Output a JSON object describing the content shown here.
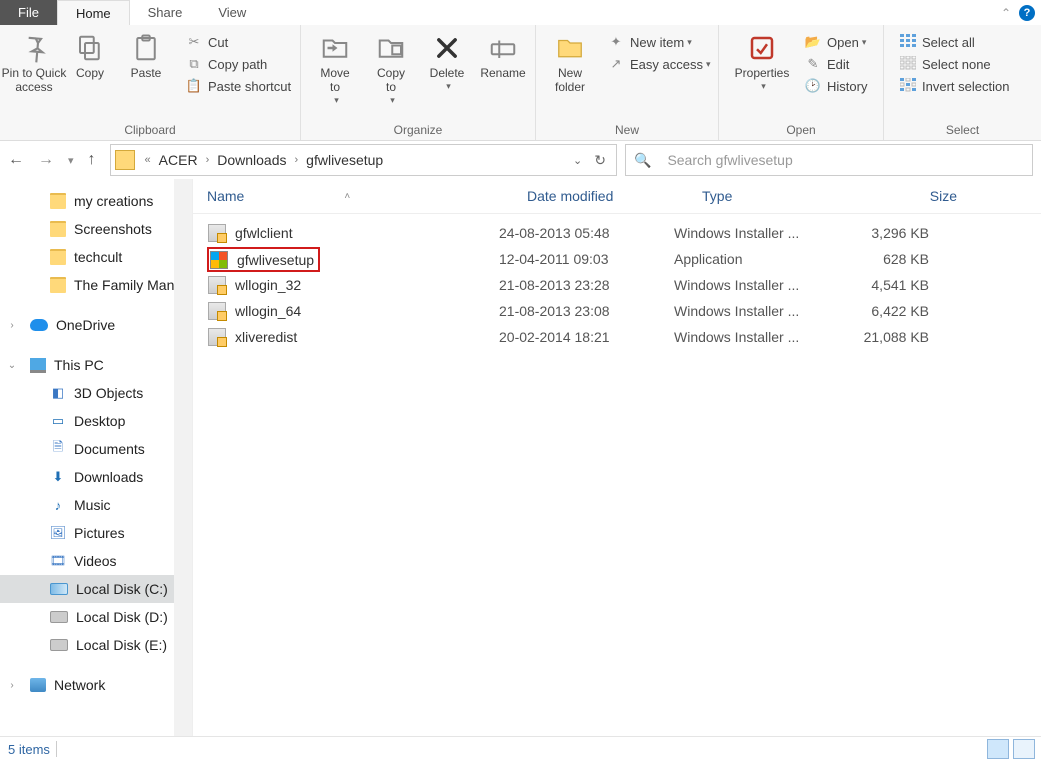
{
  "tabs": {
    "file": "File",
    "home": "Home",
    "share": "Share",
    "view": "View"
  },
  "ribbon": {
    "clipboard": {
      "label": "Clipboard",
      "pin": "Pin to Quick\naccess",
      "copy": "Copy",
      "paste": "Paste",
      "cut": "Cut",
      "copy_path": "Copy path",
      "paste_shortcut": "Paste shortcut"
    },
    "organize": {
      "label": "Organize",
      "move_to": "Move\nto",
      "copy_to": "Copy\nto",
      "delete": "Delete",
      "rename": "Rename"
    },
    "new": {
      "label": "New",
      "new_folder": "New\nfolder",
      "new_item": "New item",
      "easy_access": "Easy access"
    },
    "open": {
      "label": "Open",
      "properties": "Properties",
      "open": "Open",
      "edit": "Edit",
      "history": "History"
    },
    "select": {
      "label": "Select",
      "select_all": "Select all",
      "select_none": "Select none",
      "invert": "Invert selection"
    }
  },
  "breadcrumb": {
    "seg1": "ACER",
    "seg2": "Downloads",
    "seg3": "gfwlivesetup"
  },
  "search": {
    "placeholder": "Search gfwlivesetup"
  },
  "nav_tree": {
    "my_creations": "my creations",
    "screenshots": "Screenshots",
    "techcult": "techcult",
    "family_man": "The Family Man S",
    "onedrive": "OneDrive",
    "this_pc": "This PC",
    "objects3d": "3D Objects",
    "desktop": "Desktop",
    "documents": "Documents",
    "downloads": "Downloads",
    "music": "Music",
    "pictures": "Pictures",
    "videos": "Videos",
    "disk_c": "Local Disk (C:)",
    "disk_d": "Local Disk (D:)",
    "disk_e": "Local Disk (E:)",
    "network": "Network"
  },
  "columns": {
    "name": "Name",
    "date": "Date modified",
    "type": "Type",
    "size": "Size"
  },
  "files": [
    {
      "name": "gfwlclient",
      "date": "24-08-2013 05:48",
      "type": "Windows Installer ...",
      "size": "3,296 KB",
      "kind": "msi",
      "hl": false
    },
    {
      "name": "gfwlivesetup",
      "date": "12-04-2011 09:03",
      "type": "Application",
      "size": "628 KB",
      "kind": "exe",
      "hl": true
    },
    {
      "name": "wllogin_32",
      "date": "21-08-2013 23:28",
      "type": "Windows Installer ...",
      "size": "4,541 KB",
      "kind": "msi",
      "hl": false
    },
    {
      "name": "wllogin_64",
      "date": "21-08-2013 23:08",
      "type": "Windows Installer ...",
      "size": "6,422 KB",
      "kind": "msi",
      "hl": false
    },
    {
      "name": "xliveredist",
      "date": "20-02-2014 18:21",
      "type": "Windows Installer ...",
      "size": "21,088 KB",
      "kind": "msi",
      "hl": false
    }
  ],
  "status": {
    "items": "5 items"
  }
}
